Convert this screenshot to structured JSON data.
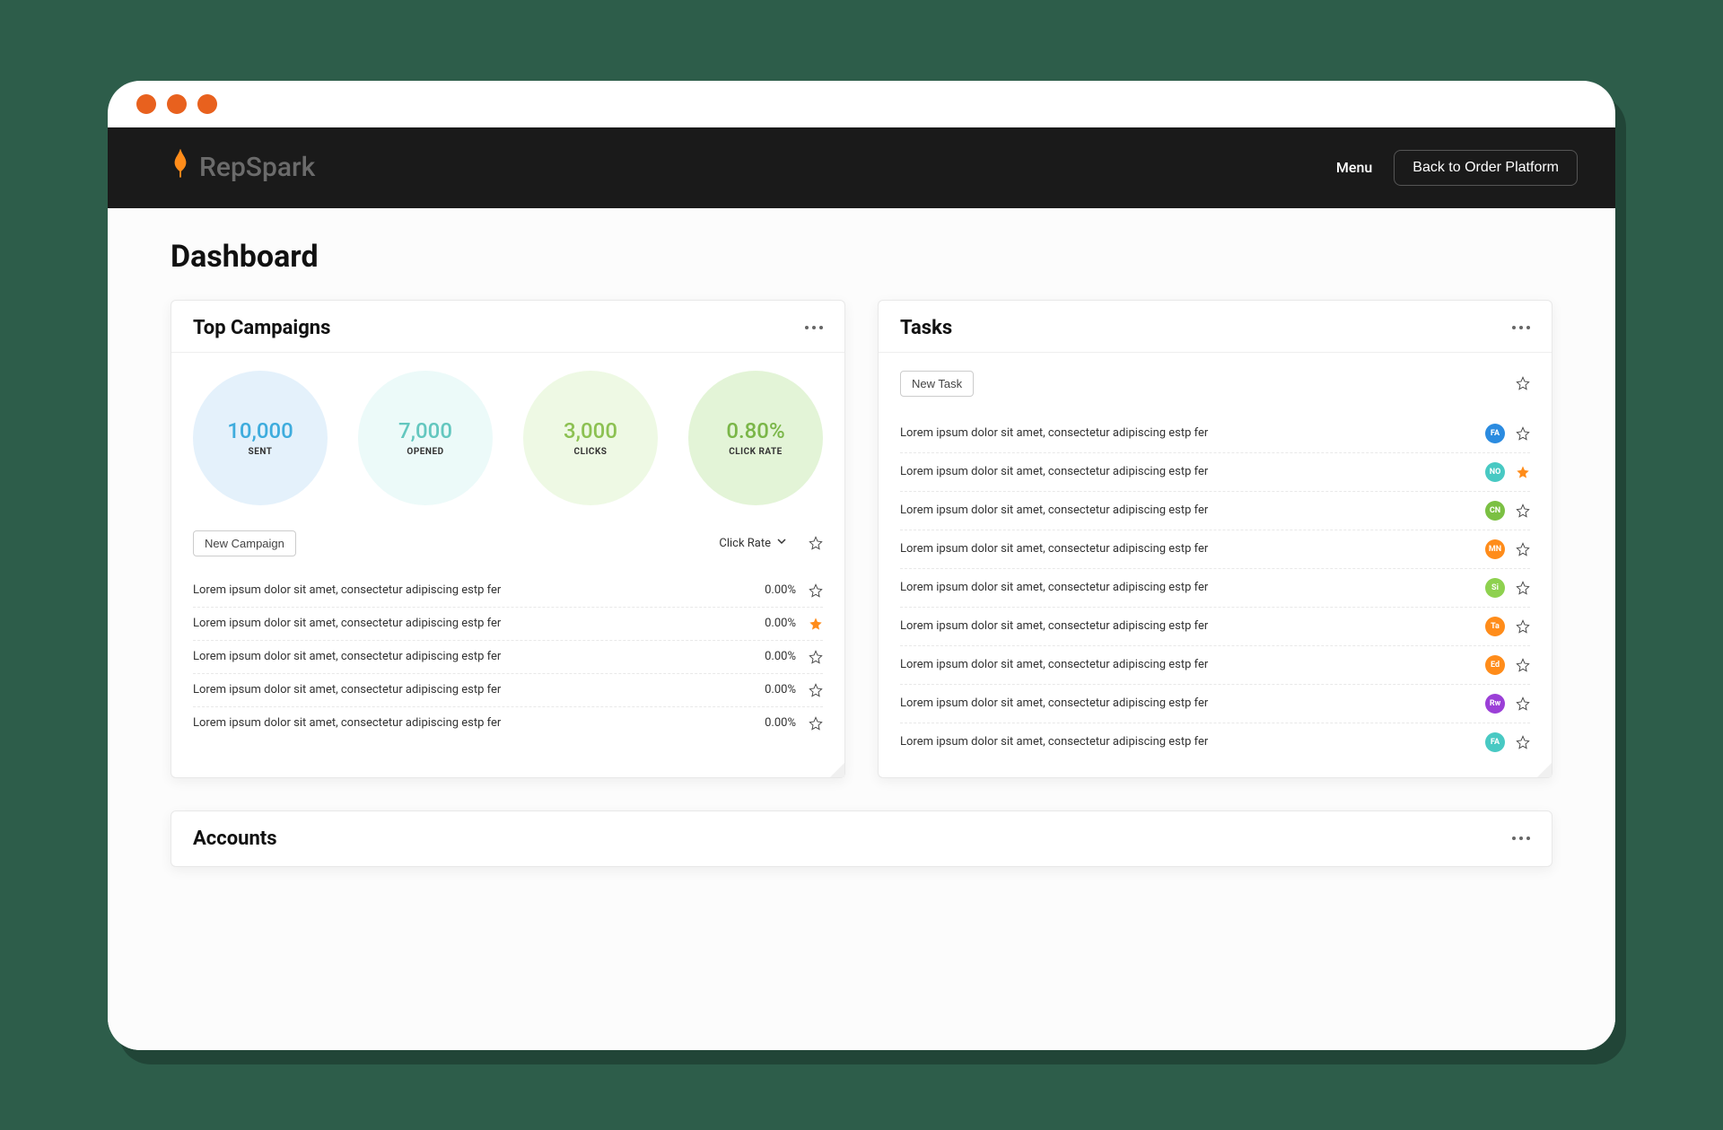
{
  "brand": {
    "name": "RepSpark"
  },
  "header": {
    "menu_label": "Menu",
    "back_label": "Back to Order Platform"
  },
  "page": {
    "title": "Dashboard"
  },
  "campaigns": {
    "title": "Top Campaigns",
    "stats": [
      {
        "value": "10,000",
        "label": "SENT"
      },
      {
        "value": "7,000",
        "label": "OPENED"
      },
      {
        "value": "3,000",
        "label": "CLICKS"
      },
      {
        "value": "0.80%",
        "label": "CLICK RATE"
      }
    ],
    "new_label": "New Campaign",
    "sort_label": "Click Rate",
    "rows": [
      {
        "text": "Lorem ipsum dolor sit amet, consectetur adipiscing estp fer",
        "value": "0.00%",
        "starred": false
      },
      {
        "text": "Lorem ipsum dolor sit amet, consectetur adipiscing estp fer",
        "value": "0.00%",
        "starred": true
      },
      {
        "text": "Lorem ipsum dolor sit amet, consectetur adipiscing estp fer",
        "value": "0.00%",
        "starred": false
      },
      {
        "text": "Lorem ipsum dolor sit amet, consectetur adipiscing estp fer",
        "value": "0.00%",
        "starred": false
      },
      {
        "text": "Lorem ipsum dolor sit amet, consectetur adipiscing estp fer",
        "value": "0.00%",
        "starred": false
      }
    ]
  },
  "tasks": {
    "title": "Tasks",
    "new_label": "New Task",
    "rows": [
      {
        "text": "Lorem ipsum dolor sit amet, consectetur adipiscing estp fer",
        "initials": "FA",
        "color": "#2b8be0",
        "starred": false
      },
      {
        "text": "Lorem ipsum dolor sit amet, consectetur adipiscing estp fer",
        "initials": "NO",
        "color": "#48c9c3",
        "starred": true
      },
      {
        "text": "Lorem ipsum dolor sit amet, consectetur adipiscing estp fer",
        "initials": "CN",
        "color": "#7bc043",
        "starred": false
      },
      {
        "text": "Lorem ipsum dolor sit amet, consectetur adipiscing estp fer",
        "initials": "MN",
        "color": "#ff8c1a",
        "starred": false
      },
      {
        "text": "Lorem ipsum dolor sit amet, consectetur adipiscing estp fer",
        "initials": "Si",
        "color": "#8ed14f",
        "starred": false
      },
      {
        "text": "Lorem ipsum dolor sit amet, consectetur adipiscing estp fer",
        "initials": "Ta",
        "color": "#ff8c1a",
        "starred": false
      },
      {
        "text": "Lorem ipsum dolor sit amet, consectetur adipiscing estp fer",
        "initials": "Ed",
        "color": "#ff8c1a",
        "starred": false
      },
      {
        "text": "Lorem ipsum dolor sit amet, consectetur adipiscing estp fer",
        "initials": "Rw",
        "color": "#9b3fd7",
        "starred": false
      },
      {
        "text": "Lorem ipsum dolor sit amet, consectetur adipiscing estp fer",
        "initials": "FA",
        "color": "#48c9c3",
        "starred": false
      }
    ]
  },
  "accounts": {
    "title": "Accounts"
  }
}
